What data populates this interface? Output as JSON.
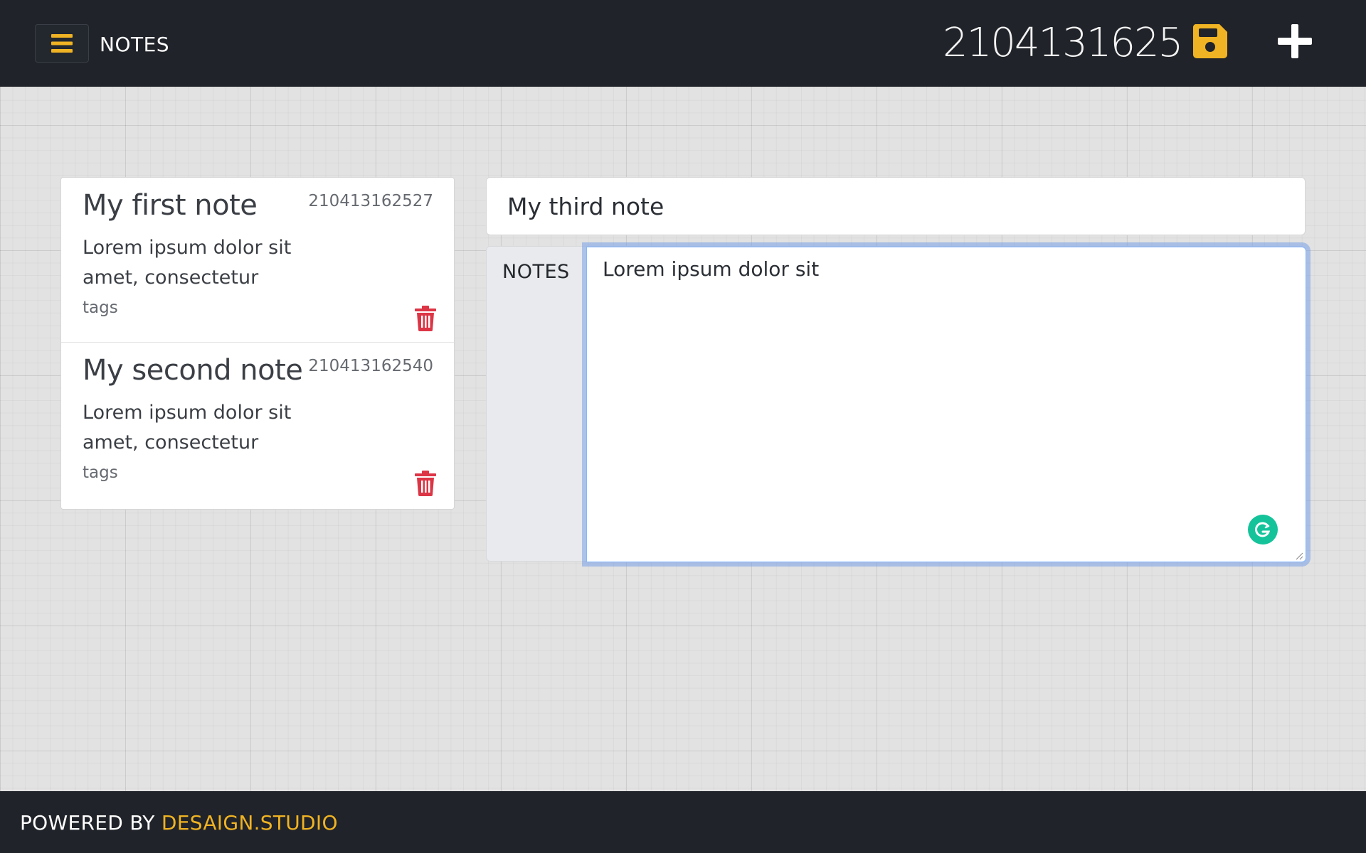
{
  "header": {
    "menu_icon": "hamburger-icon",
    "app_title": "NOTES",
    "current_id": "2104131625",
    "save_icon": "floppy-disk-icon",
    "add_icon": "plus-icon"
  },
  "note_list": [
    {
      "title": "My first note",
      "id": "210413162527",
      "body": "Lorem ipsum dolor sit amet, consectetur",
      "tags": "tags",
      "delete_icon": "trash-icon"
    },
    {
      "title": "My second note",
      "id": "210413162540",
      "body": "Lorem ipsum dolor sit amet, consectetur",
      "tags": "tags",
      "delete_icon": "trash-icon"
    }
  ],
  "editor": {
    "title_value": "My third note",
    "notes_label": "NOTES",
    "notes_value": "Lorem ipsum dolor sit",
    "grammarly_icon": "grammarly-icon"
  },
  "footer": {
    "prefix": "POWERED BY ",
    "link": "DESAIGN.STUDIO"
  },
  "colors": {
    "accent": "#f0b323",
    "danger": "#dc3545",
    "bar": "#202329",
    "focus": "#86b7fe",
    "grammarly": "#15c39a"
  }
}
